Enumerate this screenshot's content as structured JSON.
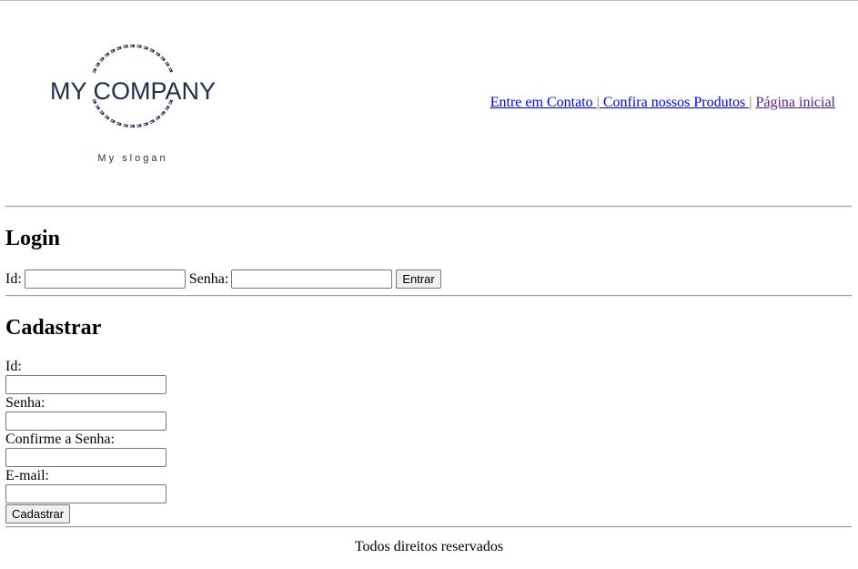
{
  "header": {
    "logo": {
      "name": "MY COMPANY",
      "slogan": "My slogan",
      "color": "#1f2d4d"
    },
    "nav": {
      "links": [
        {
          "label": "Entre em Contato "
        },
        {
          "label": " Confira nossos Produtos "
        },
        {
          "label": "Página inicial"
        }
      ],
      "separator": "|"
    }
  },
  "login": {
    "title": "Login",
    "id_label": "Id:",
    "id_value": "",
    "password_label": "Senha:",
    "password_value": "",
    "submit_label": "Entrar"
  },
  "register": {
    "title": "Cadastrar",
    "id_label": "Id:",
    "password_label": "Senha:",
    "confirm_label": "Confirme a Senha:",
    "email_label": "E-mail:",
    "submit_label": "Cadastrar"
  },
  "footer": {
    "text": "Todos direitos reservados"
  }
}
